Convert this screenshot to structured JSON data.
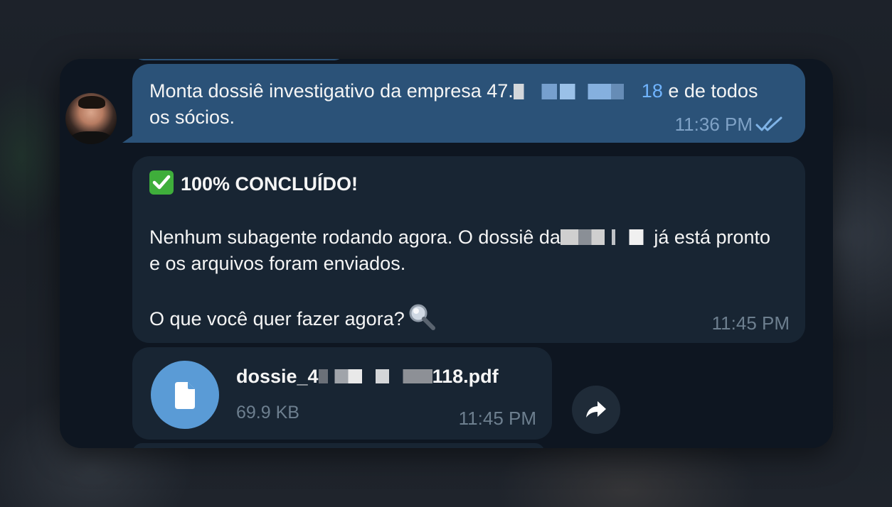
{
  "outgoing": {
    "text_before": "Monta dossiê investigativo da empresa 47.",
    "text_link_tail": "18",
    "text_after": " e de todos os sócios.",
    "time": "11:36 PM",
    "status_icon": "double-check-icon"
  },
  "incoming": {
    "title": "100% CONCLUÍDO!",
    "line1_before": "Nenhum subagente rodando agora. O dossiê da",
    "line1_after": " já está pronto e os arquivos foram enviados.",
    "question": "O que você quer fazer agora?",
    "time": "11:45 PM"
  },
  "file": {
    "name_prefix": "dossie_4",
    "name_suffix": "118.pdf",
    "size": "69.9 KB",
    "time": "11:45 PM",
    "icon": "document-icon"
  },
  "actions": {
    "share_icon": "share-forward-icon"
  },
  "colors": {
    "panel_bg": "#0e1621",
    "outgoing_bubble": "#2b5278",
    "incoming_bubble": "#182533",
    "link": "#70b4ff",
    "file_icon_bg": "#5a9bd6"
  }
}
